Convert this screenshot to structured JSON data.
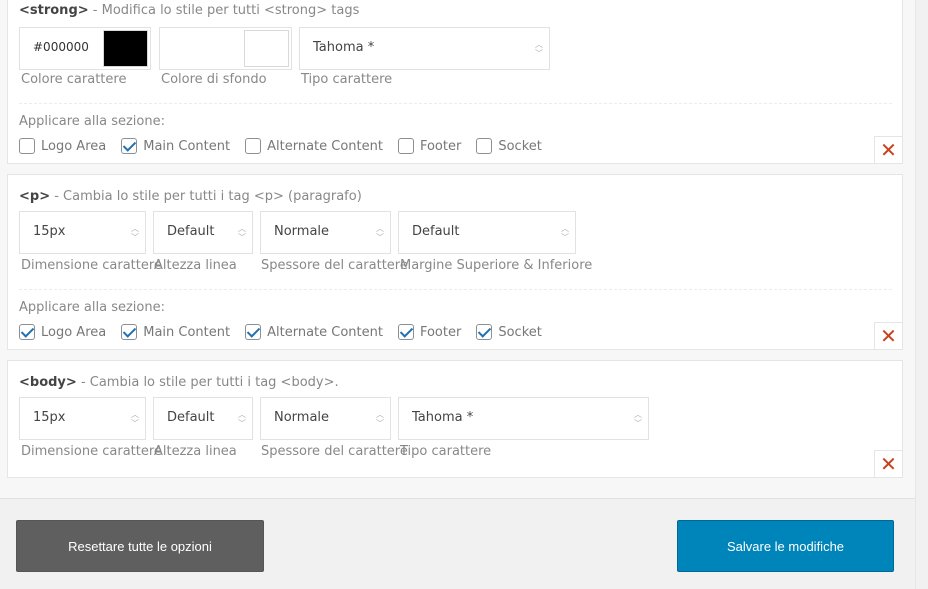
{
  "panels": {
    "strong": {
      "tag": "<strong>",
      "desc": " - Modifica lo stile per tutti <strong> tags",
      "fields": {
        "text_color": {
          "value": "#000000",
          "label": "Colore carattere",
          "swatch": "#000000"
        },
        "bg_color": {
          "value": "",
          "label": "Colore di sfondo",
          "swatch": "#ffffff"
        },
        "font_family": {
          "value": "Tahoma *",
          "label": "Tipo carattere"
        }
      },
      "apply_label": "Applicare alla sezione:",
      "sections": [
        {
          "label": "Logo Area",
          "checked": false
        },
        {
          "label": "Main Content",
          "checked": true
        },
        {
          "label": "Alternate Content",
          "checked": false
        },
        {
          "label": "Footer",
          "checked": false
        },
        {
          "label": "Socket",
          "checked": false
        }
      ],
      "remove_glyph": "✕"
    },
    "p": {
      "tag": "<p>",
      "desc": " - Cambia lo stile per tutti i tag <p> (paragrafo)",
      "fields": {
        "font_size": {
          "value": "15px",
          "label": "Dimensione carattere"
        },
        "line_height": {
          "value": "Default",
          "label": "Altezza linea"
        },
        "font_weight": {
          "value": "Normale",
          "label": "Spessore del carattere"
        },
        "margin": {
          "value": "Default",
          "label": "Margine Superiore & Inferiore"
        }
      },
      "apply_label": "Applicare alla sezione:",
      "sections": [
        {
          "label": "Logo Area",
          "checked": true
        },
        {
          "label": "Main Content",
          "checked": true
        },
        {
          "label": "Alternate Content",
          "checked": true
        },
        {
          "label": "Footer",
          "checked": true
        },
        {
          "label": "Socket",
          "checked": true
        }
      ],
      "remove_glyph": "✕"
    },
    "body": {
      "tag": "<body>",
      "desc": " - Cambia lo stile per tutti i tag <body>.",
      "fields": {
        "font_size": {
          "value": "15px",
          "label": "Dimensione carattere"
        },
        "line_height": {
          "value": "Default",
          "label": "Altezza linea"
        },
        "font_weight": {
          "value": "Normale",
          "label": "Spessore del carattere"
        },
        "font_family": {
          "value": "Tahoma *",
          "label": "Tipo carattere"
        }
      },
      "remove_glyph": "✕"
    }
  },
  "icons": {
    "stepper": "up-down-chevron-icon",
    "remove": "close-icon",
    "checkbox": "checkmark-icon"
  },
  "buttons": {
    "reset": "Resettare tutte le opzioni",
    "save": "Salvare le modifiche"
  },
  "colors": {
    "accent": "#0085ba",
    "remove": "#c9401c",
    "reset_button": "#5f5f5f",
    "checkbox_check": "#2271b1"
  }
}
